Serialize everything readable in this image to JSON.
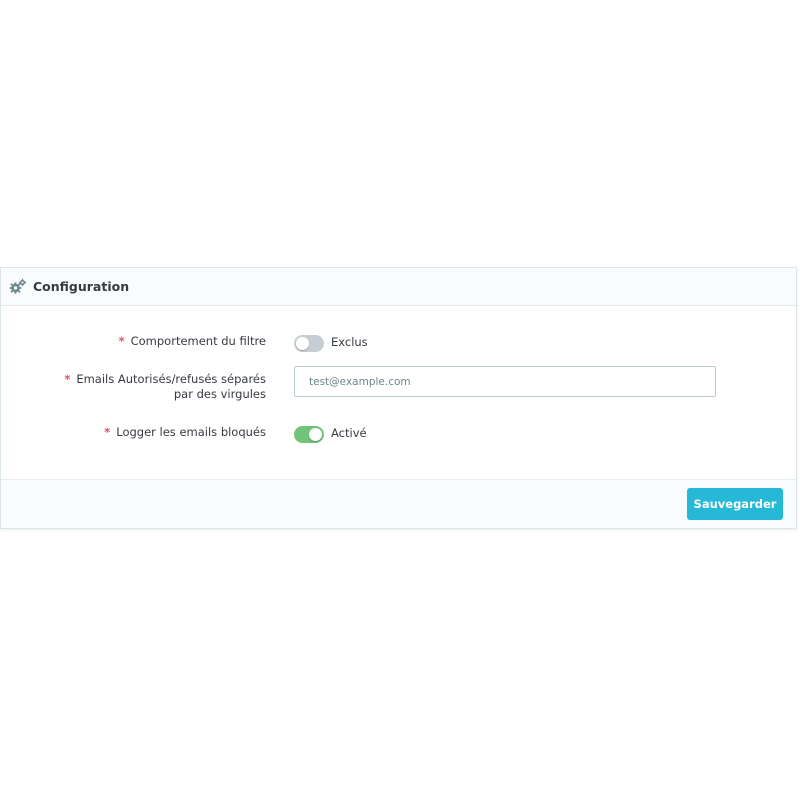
{
  "panel": {
    "title": "Configuration",
    "icon": "cogs-icon"
  },
  "form": {
    "filter_behavior": {
      "required_mark": "*",
      "label": "Comportement du filtre",
      "state": "off",
      "state_text": "Exclus"
    },
    "emails": {
      "required_mark": "*",
      "label_line1": "Emails Autorisés/refusés séparés",
      "label_line2": "par des virgules",
      "value": "",
      "placeholder": "test@example.com"
    },
    "log_blocked": {
      "required_mark": "*",
      "label": "Logger les emails bloqués",
      "state": "on",
      "state_text": "Activé"
    }
  },
  "footer": {
    "save_label": "Sauvegarder"
  },
  "colors": {
    "accent": "#25b9d7",
    "switch_on": "#72c279",
    "switch_off": "#c5ced3",
    "required": "#e84e6a"
  }
}
